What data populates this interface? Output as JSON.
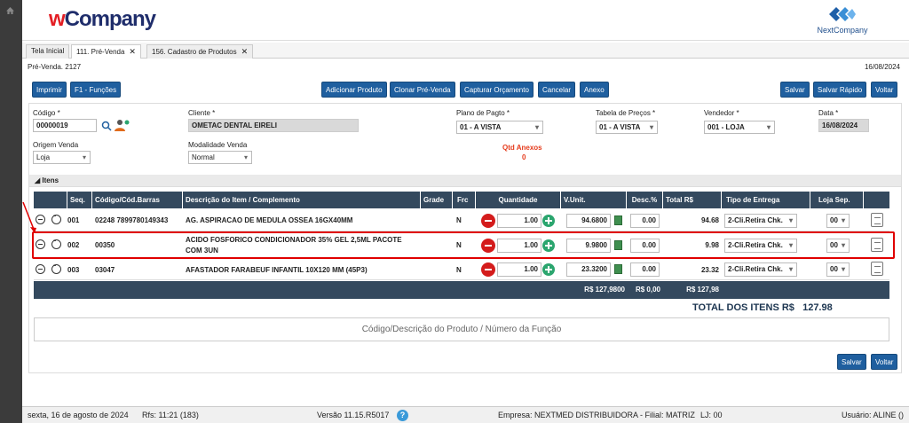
{
  "app": {
    "logo_prefix": "w",
    "logo_rest": "Company",
    "brand_right": "NextCompany"
  },
  "tabs": [
    {
      "label": "Tela Inicial"
    },
    {
      "label": "111. Pré-Venda",
      "close": "✕"
    },
    {
      "label": "156. Cadastro de Produtos",
      "close": "✕"
    }
  ],
  "page": {
    "title": "Pré-Venda. 2127",
    "date": "16/08/2024"
  },
  "toolbar": {
    "imprimir": "Imprimir",
    "funcoes": "F1 - Funções",
    "adicionar": "Adicionar Produto",
    "clonar": "Clonar Pré-Venda",
    "capturar": "Capturar Orçamento",
    "cancelar": "Cancelar",
    "anexo": "Anexo",
    "salvar": "Salvar",
    "salvar_rapido": "Salvar Rápido",
    "voltar": "Voltar"
  },
  "form": {
    "codigo_label": "Código *",
    "codigo_value": "00000019",
    "cliente_label": "Cliente *",
    "cliente_value": "OMETAC DENTAL EIRELI",
    "plano_label": "Plano de Pagto *",
    "plano_value": "01 - A VISTA",
    "tabela_label": "Tabela de Preços *",
    "tabela_value": "01 - A VISTA",
    "vendedor_label": "Vendedor *",
    "vendedor_value": "001 - LOJA",
    "data_label": "Data *",
    "data_value": "16/08/2024",
    "origem_label": "Origem Venda",
    "origem_value": "Loja",
    "modalidade_label": "Modalidade Venda",
    "modalidade_value": "Normal",
    "anexos_label": "Qtd Anexos",
    "anexos_value": "0"
  },
  "itens": {
    "title": "Itens",
    "headers": [
      "Seq.",
      "Código/Cód.Barras",
      "Descrição do Item / Complemento",
      "Grade",
      "Frc",
      "Quantidade",
      "V.Unit.",
      "Desc.%",
      "Total R$",
      "Tipo de Entrega",
      "Loja Sep."
    ],
    "rows": [
      {
        "seq": "001",
        "codigo": "02248 7899780149343",
        "desc1": "AG. ASPIRACAO DE MEDULA OSSEA 16GX40MM",
        "desc2": "",
        "frc": "N",
        "qtd": "1.00",
        "vunit": "94.6800",
        "desc": "0.00",
        "total": "94.68",
        "entrega": "2-Cli.Retira Chk.",
        "loja": "00"
      },
      {
        "seq": "002",
        "codigo": "00350",
        "desc1": "ACIDO FOSFORICO CONDICIONADOR 35% GEL 2,5ML PACOTE",
        "desc2": "COM 3UN",
        "frc": "N",
        "qtd": "1.00",
        "vunit": "9.9800",
        "desc": "0.00",
        "total": "9.98",
        "entrega": "2-Cli.Retira Chk.",
        "loja": "00"
      },
      {
        "seq": "003",
        "codigo": "03047",
        "desc1": "AFASTADOR FARABEUF INFANTIL 10X120 MM (45P3)",
        "desc2": "",
        "frc": "N",
        "qtd": "1.00",
        "vunit": "23.3200",
        "desc": "0.00",
        "total": "23.32",
        "entrega": "2-Cli.Retira Chk.",
        "loja": "00"
      }
    ],
    "footer": {
      "vunit": "R$ 127,9800",
      "desc": "R$ 0,00",
      "total": "R$ 127,98"
    },
    "total_label": "TOTAL DOS ITENS R$",
    "total_value": "127.98",
    "search_placeholder": "Código/Descrição do Produto / Número da Função"
  },
  "bottom": {
    "salvar": "Salvar",
    "voltar": "Voltar"
  },
  "status": {
    "date": "sexta, 16 de agosto de 2024",
    "rfs": "Rfs: 11:21 (183)",
    "versao": "Versão 11.15.R5017",
    "help": "?",
    "empresa": "Empresa: NEXTMED DISTRIBUIDORA - Filial: MATRIZ",
    "lj": "LJ: 00",
    "usuario": "Usuário: ALINE ()"
  },
  "colors": {
    "primary": "#1f5f9f",
    "table_header": "#34495e",
    "accent_red": "#e53b1c",
    "highlight": "#e00000"
  }
}
